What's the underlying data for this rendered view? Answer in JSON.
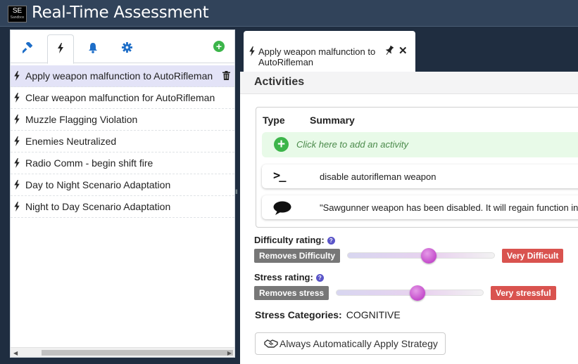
{
  "app": {
    "logo_line1": "SE",
    "logo_line2": "Sandbox",
    "title": "Real-Time Assessment"
  },
  "left_panel": {
    "tabs": [
      {
        "icon": "gavel-icon",
        "active": false
      },
      {
        "icon": "bolt-icon",
        "active": true
      },
      {
        "icon": "bell-icon",
        "active": false
      },
      {
        "icon": "gear-icon",
        "active": false
      }
    ],
    "add_icon": "plus-circle-icon",
    "items": [
      {
        "label": "Apply weapon malfunction to AutoRifleman",
        "selected": true
      },
      {
        "label": "Clear weapon malfunction for AutoRifleman",
        "selected": false
      },
      {
        "label": "Muzzle Flagging Violation",
        "selected": false
      },
      {
        "label": "Enemies Neutralized",
        "selected": false
      },
      {
        "label": "Radio Comm - begin shift fire",
        "selected": false
      },
      {
        "label": "Day to Night Scenario Adaptation",
        "selected": false
      },
      {
        "label": "Night to Day Scenario Adaptation",
        "selected": false
      }
    ]
  },
  "doc_tab": {
    "title": "Apply weapon malfunction to AutoRifleman"
  },
  "detail": {
    "activities_heading": "Activities",
    "columns": {
      "type": "Type",
      "summary": "Summary"
    },
    "add_activity": "Click here to add an activity",
    "activities": [
      {
        "type_icon": "terminal-icon",
        "type_glyph": ">_",
        "summary": "disable autorifleman weapon"
      },
      {
        "type_icon": "speech-bubble-icon",
        "summary": "\"Sawgunner weapon has been disabled. It will regain function in"
      }
    ],
    "difficulty": {
      "label": "Difficulty rating:",
      "help": "?",
      "min_label": "Removes Difficulty",
      "max_label": "Very Difficult",
      "value": 0.55
    },
    "stress": {
      "label": "Stress rating:",
      "help": "?",
      "min_label": "Removes stress",
      "max_label": "Very stressful",
      "value": 0.55
    },
    "stress_categories": {
      "label": "Stress Categories:",
      "value": "COGNITIVE"
    },
    "strategy_button": "Always Automatically Apply Strategy"
  },
  "colors": {
    "header_bg": "#31435a",
    "page_bg": "#1f2d40",
    "selected_row": "#e3e3f7",
    "add_green": "#3cb54a",
    "badge_red": "#d9534f",
    "badge_gray": "#777777",
    "slider_knob": "#c44ccb"
  }
}
